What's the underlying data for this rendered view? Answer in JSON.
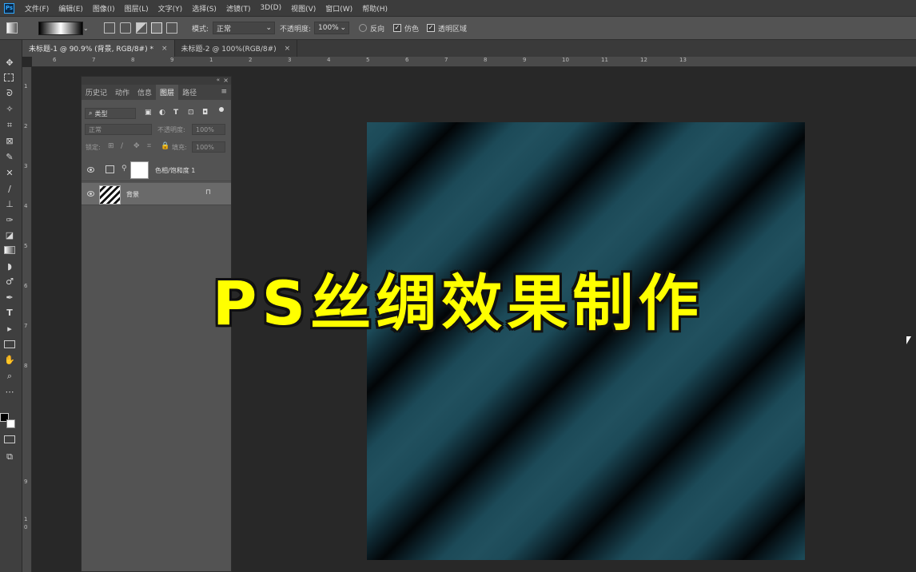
{
  "app": {
    "logo": "Ps"
  },
  "menu": [
    "文件(F)",
    "编辑(E)",
    "图像(I)",
    "图层(L)",
    "文字(Y)",
    "选择(S)",
    "滤镜(T)",
    "3D(D)",
    "视图(V)",
    "窗口(W)",
    "帮助(H)"
  ],
  "options": {
    "mode_label": "模式:",
    "mode_value": "正常",
    "opacity_label": "不透明度:",
    "opacity_value": "100%",
    "reverse_label": "反向",
    "dither_label": "仿色",
    "transparency_label": "透明区域",
    "dither_checked": true,
    "transparency_checked": true,
    "reverse_checked": false
  },
  "tabs": [
    {
      "label": "未标题-1 @ 90.9% (背景, RGB/8#) *",
      "active": true
    },
    {
      "label": "未标题-2 @ 100%(RGB/8#)",
      "active": false
    }
  ],
  "ruler_top": [
    "6",
    "7",
    "8",
    "9",
    "1",
    "2",
    "3",
    "4",
    "5",
    "6",
    "7",
    "8",
    "9",
    "10",
    "11",
    "12",
    "13"
  ],
  "ruler_left": [
    "1",
    "2",
    "3",
    "4",
    "5",
    "6",
    "7",
    "8",
    "9",
    "1",
    "0"
  ],
  "panel": {
    "tabs": [
      "历史记",
      "动作",
      "信息",
      "图层",
      "路径"
    ],
    "active_tab": "图层",
    "filter_label": "类型",
    "blend_mode": "正常",
    "opacity_label": "不透明度:",
    "opacity_value": "100%",
    "lock_label": "锁定:",
    "fill_label": "填充:",
    "fill_value": "100%",
    "layers": [
      {
        "name": "色相/饱和度 1",
        "type": "adjustment",
        "visible": true
      },
      {
        "name": "背景",
        "type": "background",
        "visible": true,
        "locked": true
      }
    ]
  },
  "overlay_title": "PS丝绸效果制作",
  "colors": {
    "title": "#ffff00",
    "canvas_light": "#21505e",
    "canvas_dark": "#020507"
  }
}
